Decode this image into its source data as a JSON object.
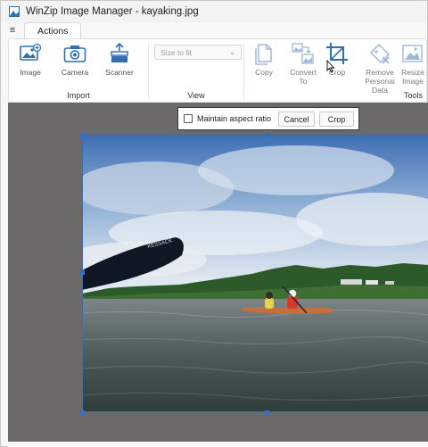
{
  "window": {
    "title": "WinZip Image Manager - kayaking.jpg"
  },
  "tabbar": {
    "menu_glyph": "≡",
    "active_tab": "Actions"
  },
  "ribbon": {
    "import": {
      "group_label": "Import",
      "buttons": [
        {
          "label": "Image",
          "icon": "image-add-icon"
        },
        {
          "label": "Camera",
          "icon": "camera-icon"
        },
        {
          "label": "Scanner",
          "icon": "scanner-icon"
        }
      ]
    },
    "view": {
      "group_label": "View",
      "select_value": "Size to fit"
    },
    "tools": {
      "group_label": "Tools",
      "buttons": [
        {
          "label": "Copy",
          "icon": "copy-icon"
        },
        {
          "label": "Convert To",
          "line1": "Convert",
          "line2": "To",
          "icon": "convert-icon"
        },
        {
          "label": "Crop",
          "icon": "crop-icon"
        },
        {
          "label": "Remove Personal Data",
          "line1": "Remove",
          "line2": "Personal Data",
          "icon": "remove-data-icon"
        },
        {
          "label": "Resize Image",
          "line1": "Resize",
          "line2": "Image",
          "icon": "resize-icon"
        }
      ]
    }
  },
  "crop_toolbar": {
    "checkbox_label": "Maintain aspect ratio",
    "checked": false,
    "cancel_label": "Cancel",
    "crop_label": "Crop"
  },
  "colors": {
    "accent": "#2f6fd1",
    "canvas_bg": "#6b6a69",
    "icon_blue": "#2e6fb3",
    "icon_disabled": "#9fb8d8"
  },
  "photo": {
    "paddle_text": "KESSACK"
  }
}
